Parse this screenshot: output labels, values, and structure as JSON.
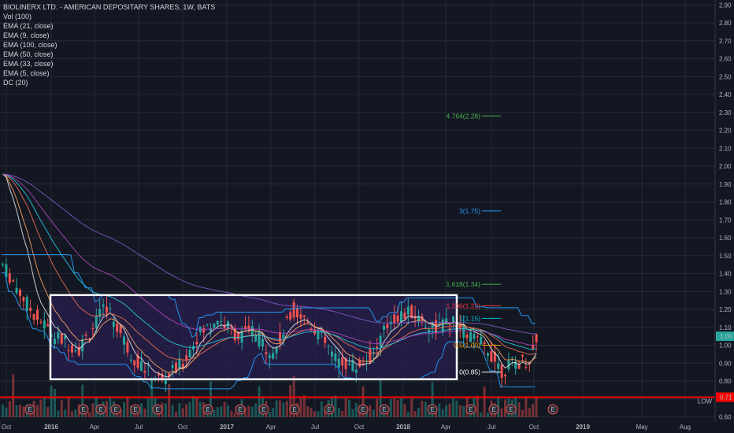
{
  "legend": {
    "title": "BIOLINERX LTD. - AMERICAN DEPOSITARY SHARES, 1W, BATS",
    "indicators": [
      "Vol (100)",
      "EMA (21, close)",
      "EMA (9, close)",
      "EMA (100, close)",
      "EMA (50, close)",
      "EMA (33, close)",
      "EMA (5, close)",
      "DC (20)"
    ]
  },
  "colors": {
    "background": "#131722",
    "grid": "#252a37",
    "up": "#26a69a",
    "down": "#ef5350",
    "box": "#ffffff",
    "low_line": "#ff0000",
    "donchian": "#2196f3",
    "box_fill": "#2a1f4e"
  },
  "chart_data": {
    "type": "candlestick",
    "yaxis": {
      "ticks": [
        "2.90",
        "2.80",
        "2.70",
        "2.60",
        "2.50",
        "2.40",
        "2.30",
        "2.20",
        "2.10",
        "2.00",
        "1.90",
        "1.80",
        "1.70",
        "1.60",
        "1.50",
        "1.40",
        "1.30",
        "1.20",
        "1.10",
        "1.00",
        "0.90",
        "0.80",
        "0.70",
        "0.60"
      ],
      "range": [
        0.6,
        2.9
      ]
    },
    "xaxis": {
      "ticks": [
        "Oct",
        "2016",
        "Apr",
        "Jul",
        "Oct",
        "2017",
        "Apr",
        "Jul",
        "Oct",
        "2018",
        "Apr",
        "Jul",
        "Oct",
        "2019",
        "May",
        "Aug"
      ]
    },
    "last_price": "1.05",
    "low_line": {
      "value": "0.71",
      "label": "LOW"
    },
    "fib_levels": [
      {
        "label": "4.764(2.28)",
        "value": 2.28,
        "color": "#4caf50"
      },
      {
        "label": "3(1.75)",
        "value": 1.75,
        "color": "#2196f3"
      },
      {
        "label": "1.618(1.34)",
        "value": 1.34,
        "color": "#4caf50"
      },
      {
        "label": "1.236(1.22)",
        "value": 1.22,
        "color": "#f23645"
      },
      {
        "label": "1(1.15)",
        "value": 1.15,
        "color": "#00bcd4"
      },
      {
        "label": "0.5(1.00)",
        "value": 1.0,
        "color": "#ff9800"
      },
      {
        "label": "0(0.85)",
        "value": 0.85,
        "color": "#ffffff"
      }
    ],
    "range_box": {
      "top": 1.28,
      "bottom": 0.81
    },
    "earnings_markers": [
      "E",
      "E",
      "E",
      "E",
      "E",
      "E",
      "E",
      "E",
      "E",
      "E",
      "E",
      "E",
      "E",
      "E",
      "E",
      "E",
      "E",
      "E",
      "E"
    ]
  }
}
